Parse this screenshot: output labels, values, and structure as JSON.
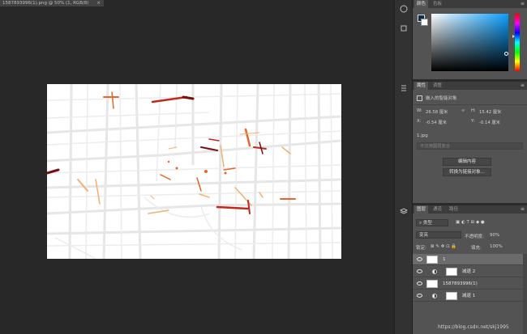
{
  "document": {
    "tab_title": "1587893996(1).png @ 50% (1, RGB/8)",
    "close_glyph": "×"
  },
  "color_panel": {
    "tabs": [
      "颜色",
      "色板"
    ],
    "menu_glyph": "≡",
    "foreground_color": "#0c2e48",
    "background_color": "#ffffff"
  },
  "properties_panel": {
    "tabs": [
      "属性",
      "调整"
    ],
    "menu_glyph": "≡",
    "object_type": "嵌入的智能对象",
    "w_label": "W:",
    "w_value": "26.58 厘米",
    "h_label": "H:",
    "h_value": "15.42 厘米",
    "x_label": "X:",
    "x_value": "-0.54 厘米",
    "y_label": "Y:",
    "y_value": "-0.14 厘米",
    "filename": "1.jpg",
    "comp_placeholder": "不应用图层复合",
    "edit_button": "编辑内容",
    "convert_button": "转换为链接对象..."
  },
  "layers_panel": {
    "tabs": [
      "图层",
      "通道",
      "路径"
    ],
    "menu_glyph": "≡",
    "kind_filter": "类型",
    "blend_mode": "变亮",
    "opacity_label": "不透明度:",
    "opacity_value": "90%",
    "lock_label": "锁定:",
    "fill_label": "填充:",
    "fill_value": "100%",
    "layers": [
      {
        "name": "1",
        "type": "smart-object",
        "selected": true
      },
      {
        "name": "减退 2",
        "type": "adjustment",
        "selected": false
      },
      {
        "name": "1587893996(1)",
        "type": "smart-object",
        "selected": false
      },
      {
        "name": "减退 1",
        "type": "adjustment",
        "selected": false
      }
    ]
  },
  "watermark": "https://blog.csdn.net/skj1995",
  "colors": {
    "canvas_bg": "#282828",
    "panel_bg": "#535353",
    "road_light": "#e3e3e3",
    "heat_yellow": "#f0b070",
    "heat_orange": "#e3662a",
    "heat_red": "#c2281e",
    "heat_dark": "#7a0e0e"
  }
}
